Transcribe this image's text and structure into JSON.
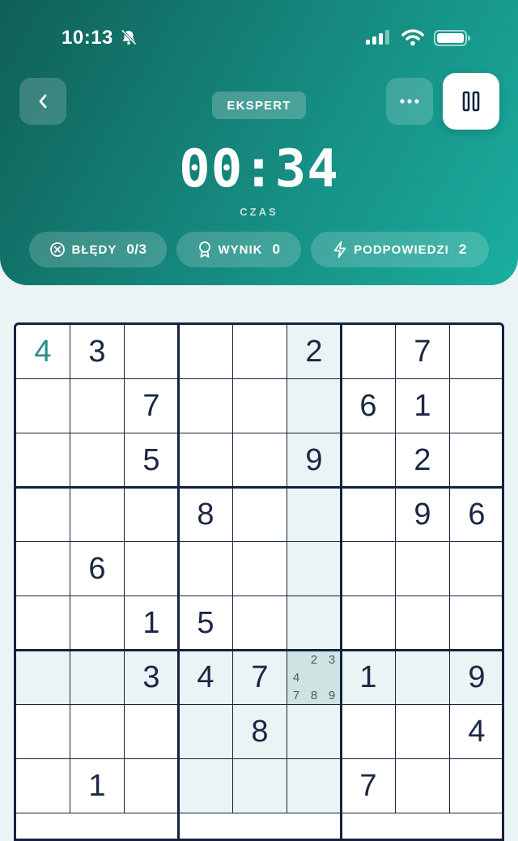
{
  "status_bar": {
    "time": "10:13"
  },
  "header": {
    "difficulty": "EKSPERT",
    "timer": "00:34",
    "timer_label": "CZAS",
    "stats": {
      "errors_label": "BŁĘDY",
      "errors_value": "0/3",
      "score_label": "WYNIK",
      "score_value": "0",
      "hints_label": "PODPOWIEDZI",
      "hints_value": "2"
    }
  },
  "colors": {
    "header_start": "#0f5f57",
    "header_end": "#1aae9f",
    "grid_line": "#14223d",
    "digit": "#1b2744",
    "user_digit": "#2a8f8c",
    "highlight": "#eaf4f4",
    "selected": "#cfe3e3"
  },
  "board": {
    "rows": [
      [
        "4",
        "3",
        "",
        "",
        "",
        "2",
        "",
        "7",
        ""
      ],
      [
        "",
        "",
        "7",
        "",
        "",
        "",
        "6",
        "1",
        ""
      ],
      [
        "",
        "",
        "5",
        "",
        "",
        "9",
        "",
        "2",
        ""
      ],
      [
        "",
        "",
        "",
        "8",
        "",
        "",
        "",
        "9",
        "6"
      ],
      [
        "",
        "6",
        "",
        "",
        "",
        "",
        "",
        "",
        ""
      ],
      [
        "",
        "",
        "1",
        "5",
        "",
        "",
        "",
        "",
        ""
      ],
      [
        "",
        "",
        "3",
        "4",
        "7",
        "",
        "1",
        "",
        "9"
      ],
      [
        "",
        "",
        "",
        "",
        "8",
        "",
        "",
        "",
        "4"
      ],
      [
        "",
        "1",
        "",
        "",
        "",
        "",
        "7",
        "",
        ""
      ]
    ],
    "user_entered": [
      [
        0,
        0
      ]
    ],
    "selected": [
      6,
      5
    ],
    "notes": {
      "6,5": [
        "",
        "2",
        "3",
        "4",
        "",
        "",
        "7",
        "8",
        "9"
      ]
    }
  }
}
